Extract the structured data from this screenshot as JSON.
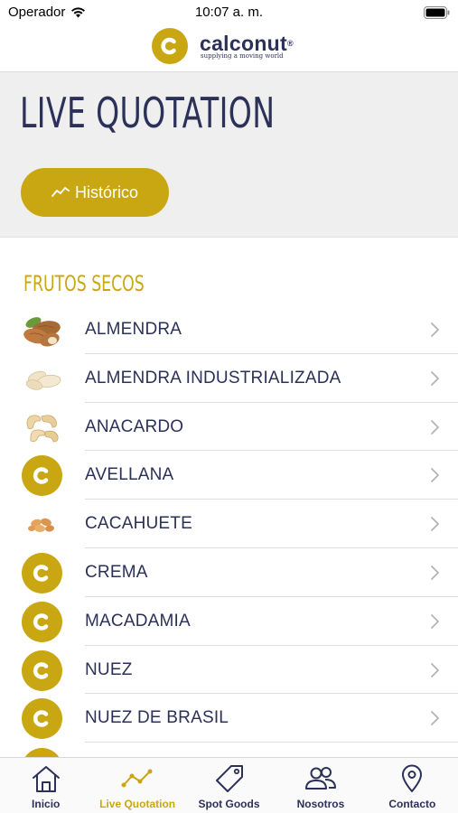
{
  "status_bar": {
    "carrier": "Operador",
    "time": "10:07 a. m."
  },
  "brand": {
    "name": "calconut",
    "trademark": "®",
    "tagline": "supplying a moving world"
  },
  "hero": {
    "title": "LIVE QUOTATION",
    "historico_button": "Histórico"
  },
  "section": {
    "title": "FRUTOS SECOS"
  },
  "products": [
    {
      "label": "ALMENDRA",
      "icon": "almond-photo"
    },
    {
      "label": "ALMENDRA INDUSTRIALIZADA",
      "icon": "blanched-almond-photo"
    },
    {
      "label": "ANACARDO",
      "icon": "cashew-photo"
    },
    {
      "label": "AVELLANA",
      "icon": "calconut-logo"
    },
    {
      "label": "CACAHUETE",
      "icon": "peanut-photo"
    },
    {
      "label": "CREMA",
      "icon": "calconut-logo"
    },
    {
      "label": "MACADAMIA",
      "icon": "calconut-logo"
    },
    {
      "label": "NUEZ",
      "icon": "calconut-logo"
    },
    {
      "label": "NUEZ DE BRASIL",
      "icon": "calconut-logo"
    }
  ],
  "tabs": [
    {
      "label": "Inicio",
      "icon": "home-icon",
      "active": false
    },
    {
      "label": "Live Quotation",
      "icon": "line-chart-icon",
      "active": true
    },
    {
      "label": "Spot Goods",
      "icon": "tag-icon",
      "active": false
    },
    {
      "label": "Nosotros",
      "icon": "people-icon",
      "active": false
    },
    {
      "label": "Contacto",
      "icon": "location-pin-icon",
      "active": false
    }
  ],
  "colors": {
    "brand_gold": "#c9a713",
    "brand_navy": "#2b3158",
    "hero_bg": "#efefef"
  }
}
